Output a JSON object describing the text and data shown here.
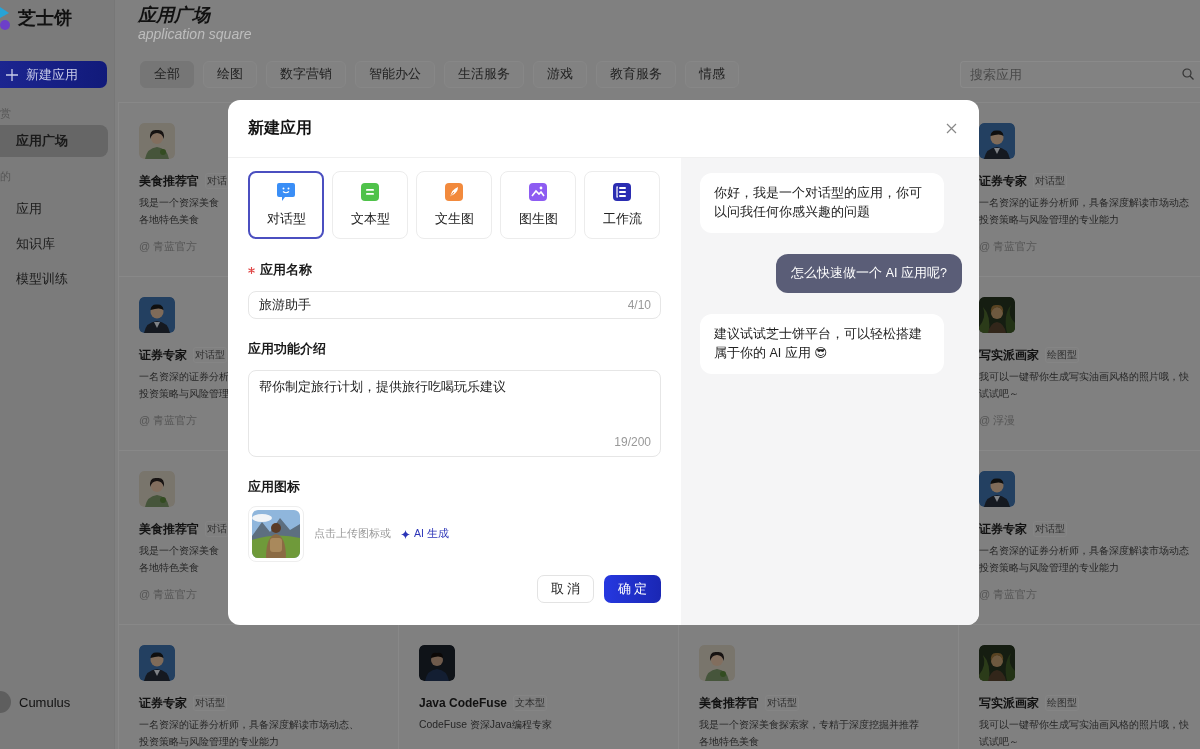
{
  "sidebar": {
    "logo": "芝士饼",
    "new_button": "新建应用",
    "sections": [
      {
        "label": "赏",
        "items": [
          {
            "label": "应用广场",
            "selected": true
          }
        ]
      },
      {
        "label": "的",
        "items": [
          {
            "label": "应用",
            "selected": false
          },
          {
            "label": "知识库",
            "selected": false
          },
          {
            "label": "模型训练",
            "selected": false
          }
        ]
      }
    ],
    "user": {
      "name": "Cumulus"
    }
  },
  "header": {
    "title": "应用广场",
    "subtitle": "application square"
  },
  "categories": [
    {
      "label": "全部",
      "selected": true
    },
    {
      "label": "绘图",
      "selected": false
    },
    {
      "label": "数字营销",
      "selected": false
    },
    {
      "label": "智能办公",
      "selected": false
    },
    {
      "label": "生活服务",
      "selected": false
    },
    {
      "label": "游戏",
      "selected": false
    },
    {
      "label": "教育服务",
      "selected": false
    },
    {
      "label": "情感",
      "selected": false
    }
  ],
  "search": {
    "placeholder": "搜索应用"
  },
  "card_rows": [
    {
      "cards": [
        {
          "kind": "food",
          "name": "美食推荐官",
          "tag": "对话",
          "lines": [
            "我是一个资深美食",
            "各地特色美食"
          ],
          "author": "@ 青蓝官方"
        },
        {
          "kind": "finance",
          "name": "证券专家",
          "tag": "对话型",
          "lines": [
            "一名资深的证券分析师，具备深度解读市场动态",
            "投资策略与风险管理的专业能力"
          ],
          "author": "@ 青蓝官方"
        }
      ]
    },
    {
      "cards": [
        {
          "kind": "finance",
          "name": "证券专家",
          "tag": "对话型",
          "lines": [
            "一名资深的证券分析",
            "投资策略与风险管理"
          ],
          "author": "@ 青蓝官方"
        },
        {
          "kind": "painting",
          "name": "写实派画家",
          "tag": "绘图型",
          "lines": [
            "我可以一键帮你生成写实油画风格的照片哦，快",
            "试试吧～"
          ],
          "author": "@ 浮漫"
        }
      ]
    },
    {
      "cards": [
        {
          "kind": "food",
          "name": "美食推荐官",
          "tag": "对话",
          "lines": [
            "我是一个资深美食",
            "各地特色美食"
          ],
          "author": "@ 青蓝官方"
        },
        {
          "kind": "finance",
          "name": "证券专家",
          "tag": "对话型",
          "lines": [
            "一名资深的证券分析师，具备深度解读市场动态",
            "投资策略与风险管理的专业能力"
          ],
          "author": "@ 青蓝官方"
        }
      ]
    },
    {
      "cards": [
        {
          "kind": "finance",
          "name": "证券专家",
          "tag": "对话型",
          "lines": [
            "一名资深的证券分析师，具备深度解读市场动态、",
            "投资策略与风险管理的专业能力"
          ]
        },
        {
          "kind": "coding",
          "name": "Java CodeFuse",
          "tag": "文本型",
          "lines": [
            "CodeFuse 资深Java编程专家"
          ]
        },
        {
          "kind": "food",
          "name": "美食推荐官",
          "tag": "对话型",
          "lines": [
            "我是一个资深美食探索家，专精于深度挖掘并推荐",
            "各地特色美食"
          ]
        },
        {
          "kind": "painting",
          "name": "写实派画家",
          "tag": "绘图型",
          "lines": [
            "我可以一键帮你生成写实油画风格的照片哦，快",
            "试试吧～"
          ]
        }
      ]
    }
  ],
  "modal": {
    "title": "新建应用",
    "types": [
      {
        "label": "对话型",
        "kind": "chat",
        "selected": true
      },
      {
        "label": "文本型",
        "kind": "text",
        "selected": false
      },
      {
        "label": "文生图",
        "kind": "text2img",
        "selected": false
      },
      {
        "label": "图生图",
        "kind": "img2img",
        "selected": false
      },
      {
        "label": "工作流",
        "kind": "workflow",
        "selected": false
      }
    ],
    "name_field": {
      "label": "应用名称",
      "required": true,
      "value": "旅游助手",
      "counter": "4/10"
    },
    "intro_field": {
      "label": "应用功能介绍",
      "value": "帮你制定旅行计划，提供旅行吃喝玩乐建议",
      "counter": "19/200"
    },
    "icon_field": {
      "label": "应用图标",
      "hint": "点击上传图标或",
      "ai_link": "AI 生成"
    },
    "buttons": [
      {
        "label": "取 消",
        "kind": "secondary"
      },
      {
        "label": "确 定",
        "kind": "primary"
      }
    ],
    "chat": [
      {
        "kind": "bot",
        "text": "你好，我是一个对话型的应用，你可以问我任何你感兴趣的问题"
      },
      {
        "kind": "user",
        "text": "怎么快速做一个 AI 应用呢?"
      },
      {
        "kind": "bot",
        "text": "建议试试芝士饼平台，可以轻松搭建属于你的 AI 应用 😎"
      }
    ]
  }
}
